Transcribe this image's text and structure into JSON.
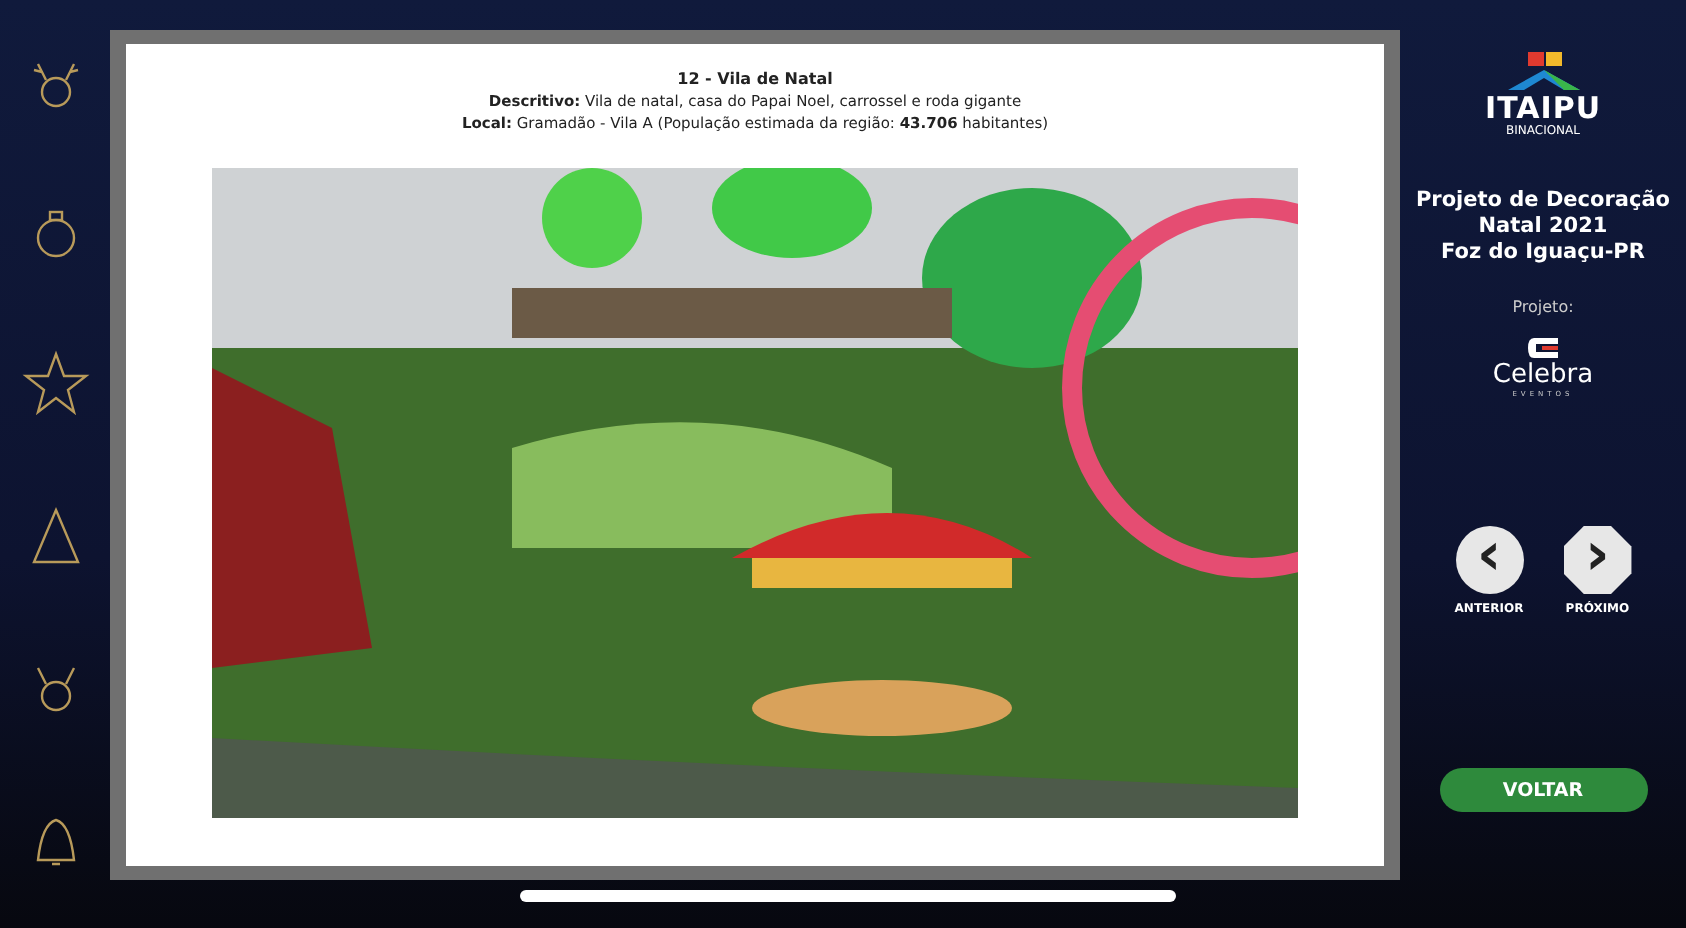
{
  "slide": {
    "title": "12 - Vila de Natal",
    "description": "**Descritivo:** Vila de natal, casa do Papai Noel, carrossel e roda gigante",
    "location": "**Local:** Gramadão - Vila A (População estimada da região: **43.706** habitantes)"
  },
  "sidebar": {
    "logo": {
      "name": "ITAIPU",
      "subtitle": "BINACIONAL"
    },
    "project_title": [
      "Projeto de Decoração",
      "Natal 2021",
      "Foz do Iguaçu-PR"
    ],
    "project_label": "Projeto:",
    "partner": {
      "name": "Celebra",
      "subtitle": "EVENTOS"
    },
    "nav": [
      {
        "kind": "prev",
        "symbol": "‹",
        "label": "ANTERIOR"
      },
      {
        "kind": "next",
        "symbol": "›",
        "label": "PRÓXIMO"
      }
    ],
    "back_button": "VOLTAR"
  }
}
